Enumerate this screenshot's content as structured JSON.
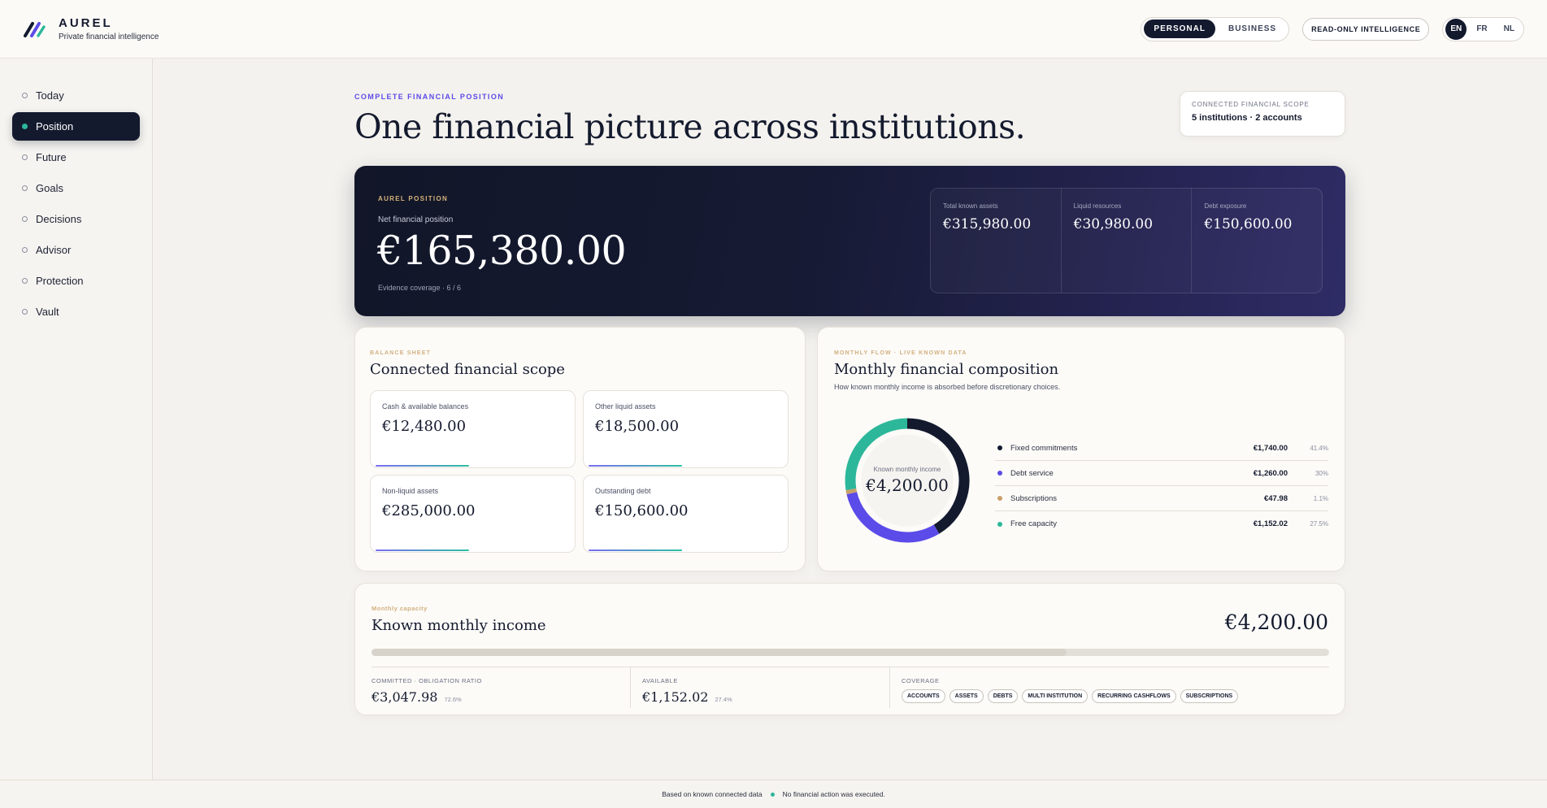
{
  "brand": {
    "name": "AUREL",
    "tagline": "Private financial intelligence"
  },
  "topbar": {
    "modes": [
      "PERSONAL",
      "BUSINESS"
    ],
    "active_mode": "PERSONAL",
    "readonly_label": "READ-ONLY INTELLIGENCE",
    "languages": [
      "EN",
      "FR",
      "NL"
    ],
    "active_language": "EN"
  },
  "sidebar": {
    "items": [
      {
        "label": "Today"
      },
      {
        "label": "Position"
      },
      {
        "label": "Future"
      },
      {
        "label": "Goals"
      },
      {
        "label": "Decisions"
      },
      {
        "label": "Advisor"
      },
      {
        "label": "Protection"
      },
      {
        "label": "Vault"
      }
    ],
    "active": "Position"
  },
  "hero": {
    "eyebrow": "COMPLETE FINANCIAL POSITION",
    "title": "One financial picture across institutions.",
    "scope_label": "CONNECTED FINANCIAL SCOPE",
    "scope_value": "5 institutions · 2 accounts"
  },
  "position": {
    "tag": "AUREL POSITION",
    "label": "Net financial position",
    "value": "€165,380.00",
    "evidence": "Evidence coverage · 6 / 6",
    "metrics": [
      {
        "label": "Total known assets",
        "value": "€315,980.00"
      },
      {
        "label": "Liquid resources",
        "value": "€30,980.00"
      },
      {
        "label": "Debt exposure",
        "value": "€150,600.00"
      }
    ]
  },
  "balance_sheet": {
    "eyebrow": "BALANCE SHEET",
    "title": "Connected financial scope",
    "boxes": [
      {
        "label": "Cash & available balances",
        "value": "€12,480.00"
      },
      {
        "label": "Other liquid assets",
        "value": "€18,500.00"
      },
      {
        "label": "Non-liquid assets",
        "value": "€285,000.00"
      },
      {
        "label": "Outstanding debt",
        "value": "€150,600.00"
      }
    ]
  },
  "monthly_flow": {
    "eyebrow": "MONTHLY FLOW · LIVE KNOWN DATA",
    "title": "Monthly financial composition",
    "subtitle": "How known monthly income is absorbed before discretionary choices.",
    "center_label": "Known monthly income",
    "center_value": "€4,200.00",
    "items": [
      {
        "label": "Fixed commitments",
        "value": "€1,740.00",
        "pct": "41.4%",
        "fraction": 0.414,
        "color": "#141a2e"
      },
      {
        "label": "Debt service",
        "value": "€1,260.00",
        "pct": "30%",
        "fraction": 0.3,
        "color": "#5b4be8"
      },
      {
        "label": "Subscriptions",
        "value": "€47.98",
        "pct": "1.1%",
        "fraction": 0.011,
        "color": "#c9a06a"
      },
      {
        "label": "Free capacity",
        "value": "€1,152.02",
        "pct": "27.5%",
        "fraction": 0.275,
        "color": "#2cb79a"
      }
    ]
  },
  "income": {
    "eyebrow": "Monthly capacity",
    "title": "Known monthly income",
    "amount": "€4,200.00",
    "committed_fraction": 0.726,
    "committed_label": "COMMITTED · OBLIGATION RATIO",
    "committed_value": "€3,047.98",
    "committed_pct": "72.6%",
    "available_label": "AVAILABLE",
    "available_value": "€1,152.02",
    "available_pct": "27.4%",
    "coverage_label": "COVERAGE",
    "coverage_chips": [
      "ACCOUNTS",
      "ASSETS",
      "DEBTS",
      "MULTI INSTITUTION",
      "RECURRING CASHFLOWS",
      "SUBSCRIPTIONS"
    ]
  },
  "footer": {
    "left": "Based on known connected data",
    "right": "No financial action was executed."
  }
}
